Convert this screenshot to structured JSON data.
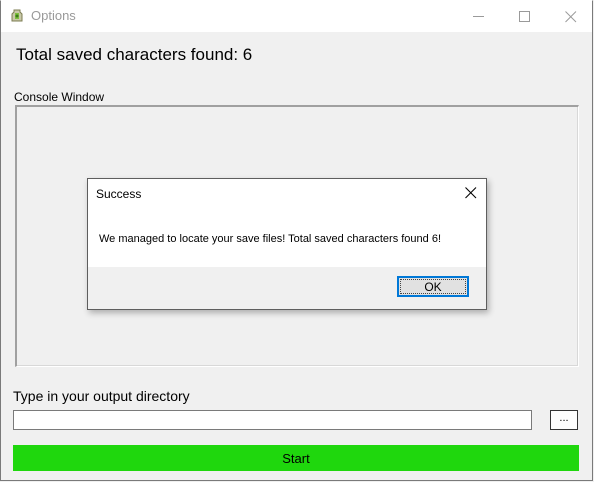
{
  "window": {
    "title": "Options",
    "icon": "app-icon"
  },
  "main": {
    "heading": "Total saved characters found: 6",
    "console_label": "Console Window",
    "output_label": "Type in your output directory",
    "output_value": "",
    "browse_label": "...",
    "start_label": "Start",
    "start_color": "#1fd70d"
  },
  "dialog": {
    "title": "Success",
    "message": "We managed to locate your save files! Total saved characters found 6!",
    "ok_label": "OK",
    "focus_color": "#0078d7"
  }
}
